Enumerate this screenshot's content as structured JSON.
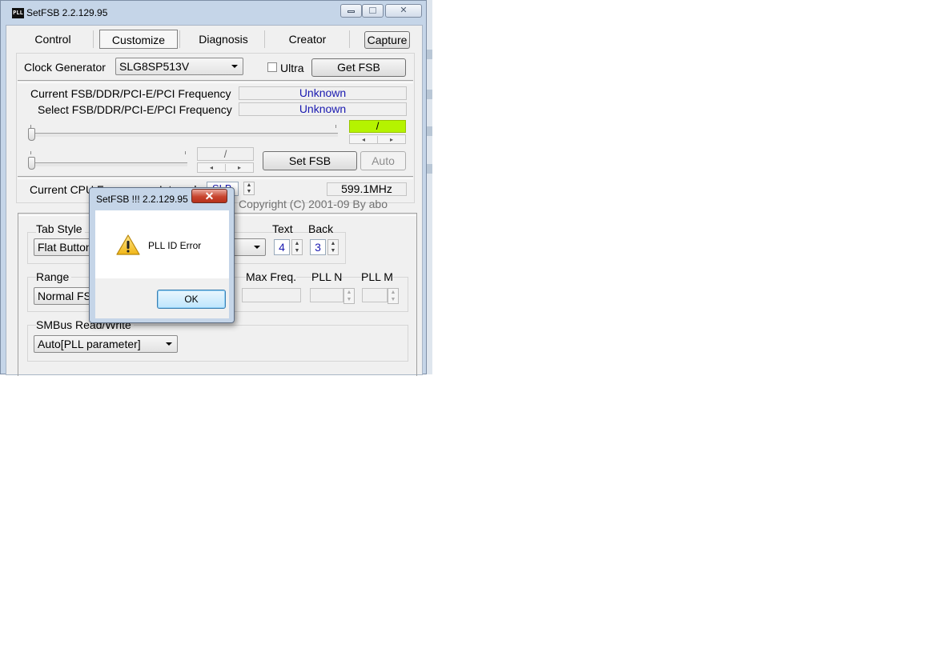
{
  "window": {
    "title": "SetFSB 2.2.129.95",
    "app_icon_text": "PLL",
    "controls": {
      "minimize": "▭",
      "maximize": "▢",
      "close": "✕"
    }
  },
  "tabs": [
    {
      "label": "Control"
    },
    {
      "label": "Customize",
      "selected": true
    },
    {
      "label": "Diagnosis"
    },
    {
      "label": "Creator"
    }
  ],
  "capture_label": "Capture",
  "clock": {
    "label": "Clock Generator",
    "selected": "SLG8SP513V",
    "ultra_label": "Ultra",
    "ultra_checked": false,
    "get_fsb_label": "Get FSB"
  },
  "freq": {
    "current_label": "Current FSB/DDR/PCI-E/PCI Frequency",
    "current_value": "Unknown",
    "select_label": "Select FSB/DDR/PCI-E/PCI Frequency",
    "select_value": "Unknown",
    "green_value": "/",
    "small_value": "/",
    "set_fsb_label": "Set FSB",
    "auto_label": "Auto"
  },
  "cpu": {
    "label": "Current CPU Frequency : Internal",
    "mode": "SLB",
    "value": "599.1MHz",
    "copyright": "Copyright (C) 2001-09 By abo"
  },
  "customize": {
    "tab_style_label": "Tab Style",
    "tab_style_value": "Flat Button",
    "color_value": "r",
    "text_label": "Text",
    "text_value": "4",
    "back_label": "Back",
    "back_value": "3",
    "range_label": "Range",
    "range_value": "Normal FS",
    "max_freq_label": "Max Freq.",
    "pll_n_label": "PLL N",
    "pll_m_label": "PLL M",
    "smbus_label": "SMBus Read/Write",
    "smbus_value": "Auto[PLL parameter]"
  },
  "dialog": {
    "title": "SetFSB !!!  2.2.129.95",
    "close": "✕",
    "message": "PLL ID Error",
    "ok_label": "OK",
    "icon": "warning-icon",
    "accent": "#3c7fb1"
  }
}
